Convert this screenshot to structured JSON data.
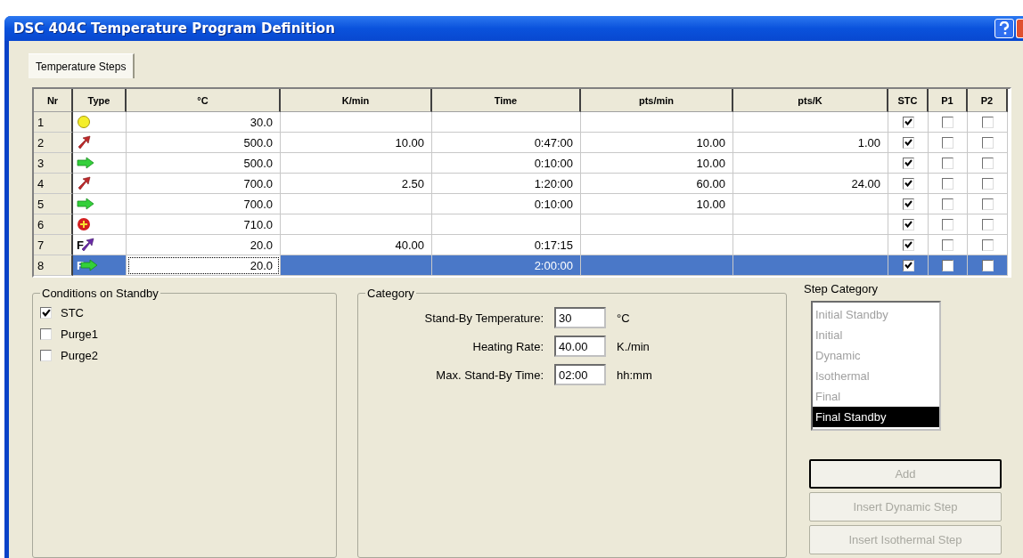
{
  "window": {
    "title": "DSC 404C Temperature Program Definition"
  },
  "tabs": [
    {
      "label": "Temperature Steps",
      "selected": true
    }
  ],
  "table": {
    "columns": [
      "Nr",
      "Type",
      "°C",
      "K/min",
      "Time",
      "pts/min",
      "pts/K",
      "STC",
      "P1",
      "P2"
    ],
    "rows": [
      {
        "nr": "1",
        "kind": "initial_standby",
        "temp": "30.0",
        "rate": "",
        "time": "",
        "pts_min": "",
        "pts_k": "",
        "stc": true,
        "p1": false,
        "p2": false,
        "selected": false,
        "editing": false
      },
      {
        "nr": "2",
        "kind": "dynamic",
        "temp": "500.0",
        "rate": "10.00",
        "time": "0:47:00",
        "pts_min": "10.00",
        "pts_k": "1.00",
        "stc": true,
        "p1": false,
        "p2": false,
        "selected": false,
        "editing": false
      },
      {
        "nr": "3",
        "kind": "isothermal",
        "temp": "500.0",
        "rate": "",
        "time": "0:10:00",
        "pts_min": "10.00",
        "pts_k": "",
        "stc": true,
        "p1": false,
        "p2": false,
        "selected": false,
        "editing": false
      },
      {
        "nr": "4",
        "kind": "dynamic",
        "temp": "700.0",
        "rate": "2.50",
        "time": "1:20:00",
        "pts_min": "60.00",
        "pts_k": "24.00",
        "stc": true,
        "p1": false,
        "p2": false,
        "selected": false,
        "editing": false
      },
      {
        "nr": "5",
        "kind": "isothermal",
        "temp": "700.0",
        "rate": "",
        "time": "0:10:00",
        "pts_min": "10.00",
        "pts_k": "",
        "stc": true,
        "p1": false,
        "p2": false,
        "selected": false,
        "editing": false
      },
      {
        "nr": "6",
        "kind": "final",
        "temp": "710.0",
        "rate": "",
        "time": "",
        "pts_min": "",
        "pts_k": "",
        "stc": true,
        "p1": false,
        "p2": false,
        "selected": false,
        "editing": false
      },
      {
        "nr": "7",
        "kind": "final_dynamic",
        "badge": "F",
        "temp": "20.0",
        "rate": "40.00",
        "time": "0:17:15",
        "pts_min": "",
        "pts_k": "",
        "stc": true,
        "p1": false,
        "p2": false,
        "selected": false,
        "editing": false
      },
      {
        "nr": "8",
        "kind": "final_standby",
        "badge": "F",
        "temp": "20.0",
        "rate": "",
        "time": "2:00:00",
        "pts_min": "",
        "pts_k": "",
        "stc": true,
        "p1": false,
        "p2": false,
        "selected": true,
        "editing": true
      }
    ]
  },
  "conditions": {
    "title": "Conditions on Standby",
    "items": [
      {
        "label": "STC",
        "checked": true
      },
      {
        "label": "Purge1",
        "checked": false
      },
      {
        "label": "Purge2",
        "checked": false
      }
    ]
  },
  "category": {
    "title": "Category",
    "fields": [
      {
        "label": "Stand-By Temperature:",
        "value": "30",
        "unit": "°C"
      },
      {
        "label": "Heating Rate:",
        "value": "40.00",
        "unit": "K./min"
      },
      {
        "label": "Max. Stand-By Time:",
        "value": "02:00",
        "unit": "hh:mm"
      }
    ]
  },
  "step_category": {
    "label": "Step Category",
    "items": [
      {
        "label": "Initial Standby",
        "selected": false
      },
      {
        "label": "Initial",
        "selected": false
      },
      {
        "label": "Dynamic",
        "selected": false
      },
      {
        "label": "Isothermal",
        "selected": false
      },
      {
        "label": "Final",
        "selected": false
      },
      {
        "label": "Final Standby",
        "selected": true
      }
    ]
  },
  "buttons": [
    {
      "label": "Add",
      "disabled": true,
      "default": true
    },
    {
      "label": "Insert Dynamic Step",
      "disabled": true,
      "default": false
    },
    {
      "label": "Insert Isothermal Step",
      "disabled": true,
      "default": false
    }
  ]
}
